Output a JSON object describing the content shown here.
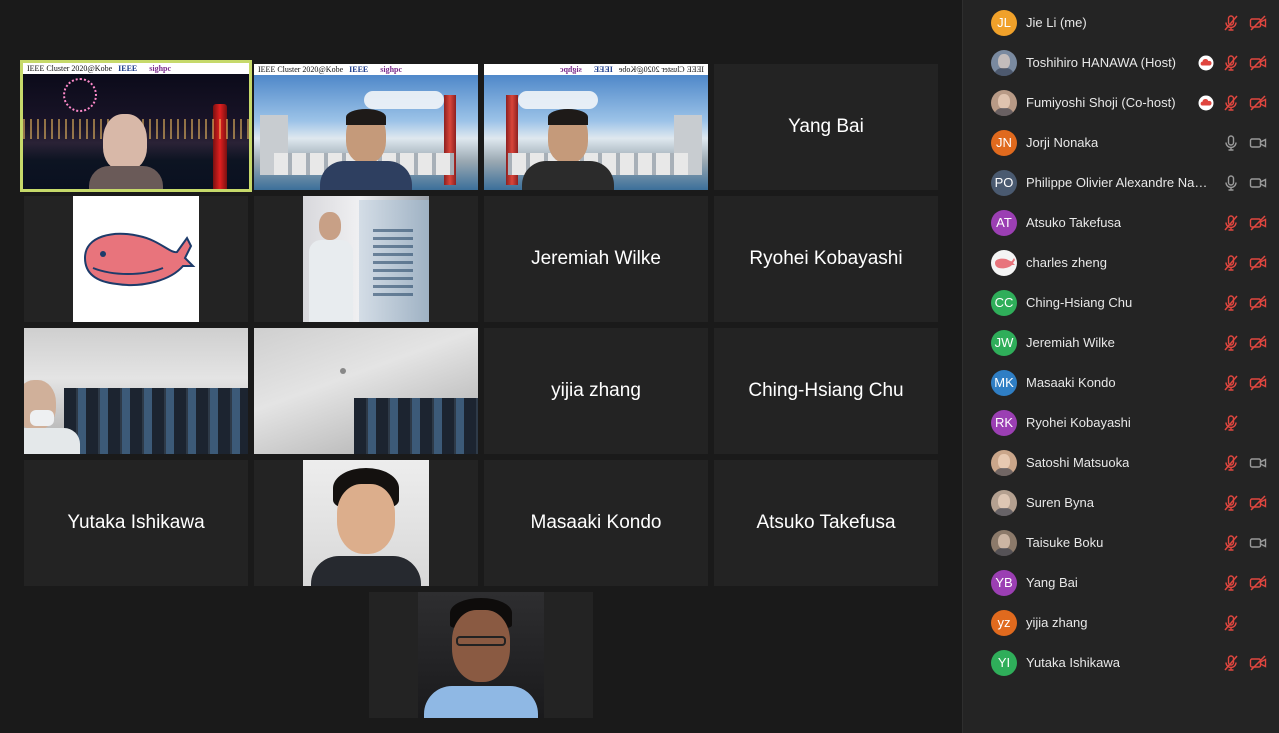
{
  "video_grid": {
    "tiles": [
      {
        "kind": "video",
        "scene": "night-port",
        "banner": "IEEE Cluster 2020@Kobe",
        "active": true
      },
      {
        "kind": "video",
        "scene": "kobe-man1",
        "banner": "IEEE Cluster 2020@Kobe"
      },
      {
        "kind": "video",
        "scene": "kobe-man2",
        "banner": "IEEE Cluster 2020@Kobe",
        "mirrored": true
      },
      {
        "kind": "name",
        "label": "Yang Bai"
      },
      {
        "kind": "video",
        "scene": "whale"
      },
      {
        "kind": "video",
        "scene": "oakforest"
      },
      {
        "kind": "name",
        "label": "Jeremiah Wilke"
      },
      {
        "kind": "name",
        "label": "Ryohei Kobayashi"
      },
      {
        "kind": "video",
        "scene": "server-room-1"
      },
      {
        "kind": "video",
        "scene": "server-room-2"
      },
      {
        "kind": "name",
        "label": "yijia zhang"
      },
      {
        "kind": "name",
        "label": "Ching-Hsiang Chu"
      },
      {
        "kind": "name",
        "label": "Yutaka Ishikawa"
      },
      {
        "kind": "video",
        "scene": "portrait-asian"
      },
      {
        "kind": "name",
        "label": "Masaaki Kondo"
      },
      {
        "kind": "name",
        "label": "Atsuko Takefusa"
      },
      {
        "kind": "video",
        "scene": "portrait-blue-shirt"
      }
    ],
    "banner_logos": [
      "IEEE",
      "sighpc"
    ],
    "active_speaker_color": "#c6d96a"
  },
  "participants": [
    {
      "name": "Jie Li (me)",
      "initials": "JL",
      "color": "#f0a12a",
      "mic": "muted",
      "video": "off"
    },
    {
      "name": "Toshihiro HANAWA (Host)",
      "photo": true,
      "photo_color": "#7a8aa0",
      "badge": "cloud-icon",
      "mic": "muted",
      "video": "off"
    },
    {
      "name": "Fumiyoshi Shoji (Co-host)",
      "photo": true,
      "photo_color": "#b89a86",
      "badge": "cloud-icon",
      "mic": "muted",
      "video": "off"
    },
    {
      "name": "Jorji Nonaka",
      "initials": "JN",
      "color": "#e06a1e",
      "mic": "on",
      "video": "on"
    },
    {
      "name": "Philippe Olivier Alexandre Navaro",
      "initials": "PO",
      "color": "#4a5a70",
      "mic": "on",
      "video": "on"
    },
    {
      "name": "Atsuko Takefusa",
      "initials": "AT",
      "color": "#9b3fb3",
      "mic": "muted",
      "video": "off"
    },
    {
      "name": "charles zheng",
      "photo": true,
      "photo_color": "#f4f4f4",
      "mic": "muted",
      "video": "off"
    },
    {
      "name": "Ching-Hsiang Chu",
      "initials": "CC",
      "color": "#2fae5a",
      "mic": "muted",
      "video": "off"
    },
    {
      "name": "Jeremiah Wilke",
      "initials": "JW",
      "color": "#2fae5a",
      "mic": "muted",
      "video": "off"
    },
    {
      "name": "Masaaki Kondo",
      "initials": "MK",
      "color": "#2f7ec4",
      "mic": "muted",
      "video": "off"
    },
    {
      "name": "Ryohei Kobayashi",
      "initials": "RK",
      "color": "#9b3fb3",
      "mic": "muted",
      "video": "none"
    },
    {
      "name": "Satoshi Matsuoka",
      "photo": true,
      "photo_color": "#caa68a",
      "mic": "muted",
      "video": "on"
    },
    {
      "name": "Suren Byna",
      "photo": true,
      "photo_color": "#b4a090",
      "mic": "muted",
      "video": "off"
    },
    {
      "name": "Taisuke Boku",
      "photo": true,
      "photo_color": "#8c7a6a",
      "mic": "muted",
      "video": "on"
    },
    {
      "name": "Yang Bai",
      "initials": "YB",
      "color": "#9b3fb3",
      "mic": "muted",
      "video": "off"
    },
    {
      "name": "yijia zhang",
      "initials": "yz",
      "color": "#e06a1e",
      "mic": "muted",
      "video": "none"
    },
    {
      "name": "Yutaka Ishikawa",
      "initials": "YI",
      "color": "#2fae5a",
      "mic": "muted",
      "video": "off"
    }
  ],
  "colors": {
    "muted_icon": "#e0463f",
    "neutral_icon": "#9a9a9a"
  }
}
